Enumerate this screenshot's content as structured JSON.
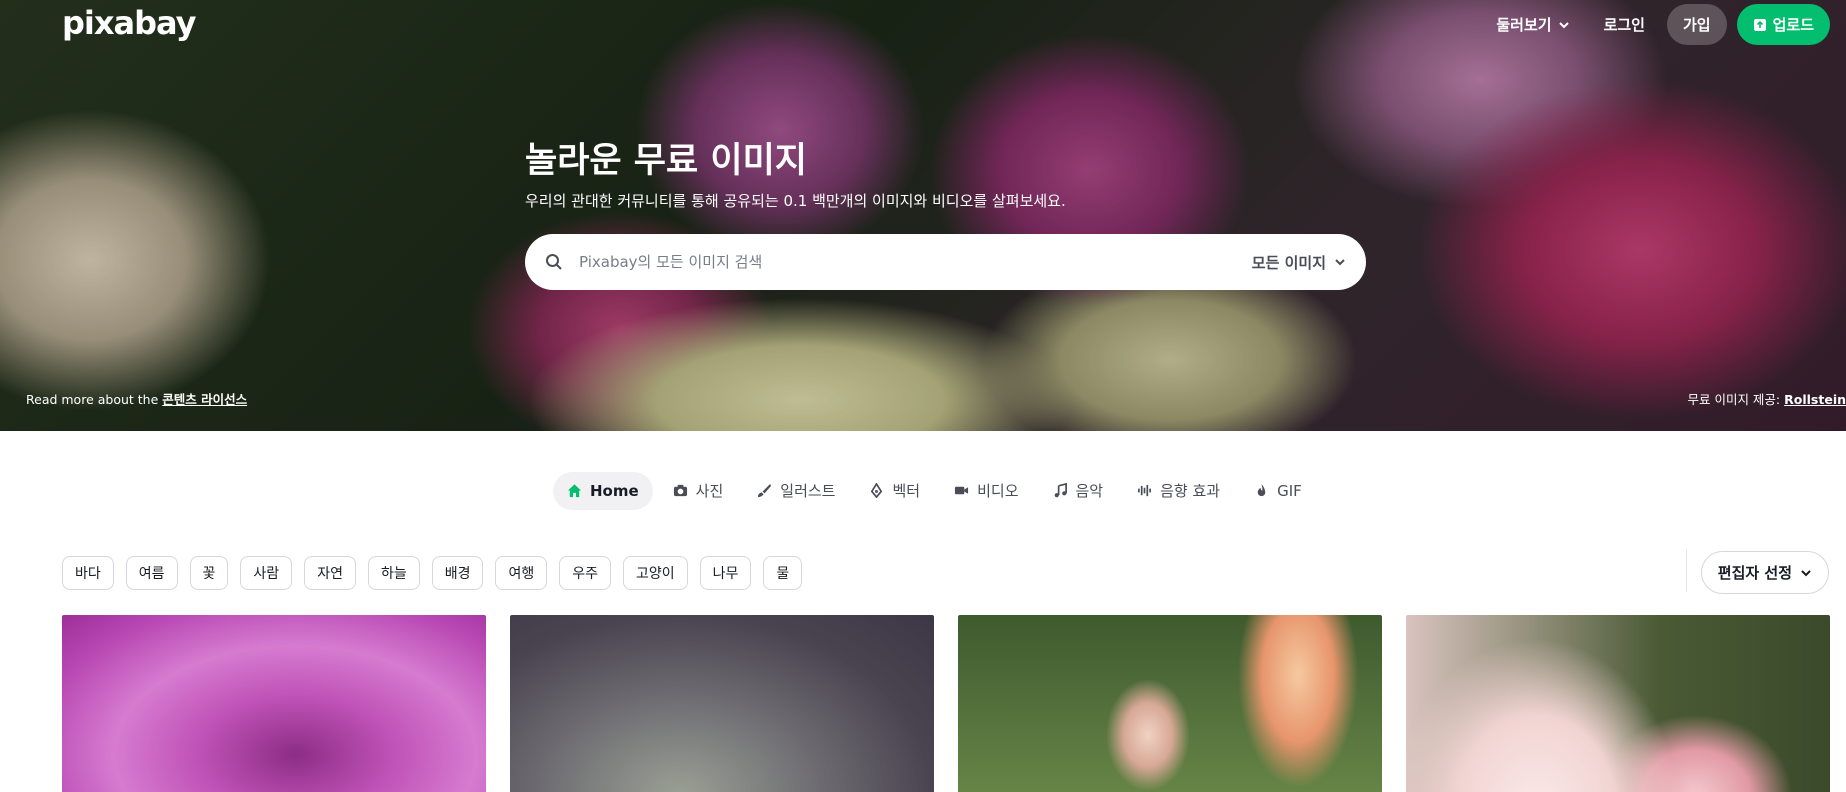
{
  "brand": {
    "logo_text": "pixabay"
  },
  "nav": {
    "explore_label": "둘러보기",
    "login_label": "로그인",
    "join_label": "가입",
    "upload_label": "업로드"
  },
  "hero": {
    "title": "놀라운 무료 이미지",
    "subtitle": "우리의 관대한 커뮤니티를 통해 공유되는 0.1 백만개의 이미지와 비디오를 살펴보세요.",
    "search_placeholder": "Pixabay의 모든 이미지 검색",
    "search_type": "모든 이미지",
    "license_prefix": "Read more about the",
    "license_link": "콘텐츠 라이선스",
    "credit_prefix": "무료 이미지 제공:",
    "credit_link": "Rollstein"
  },
  "tabs": [
    {
      "label": "Home",
      "icon": "home-icon"
    },
    {
      "label": "사진",
      "icon": "camera-icon"
    },
    {
      "label": "일러스트",
      "icon": "brush-icon"
    },
    {
      "label": "벡터",
      "icon": "pen-nib-icon"
    },
    {
      "label": "비디오",
      "icon": "video-icon"
    },
    {
      "label": "음악",
      "icon": "music-icon"
    },
    {
      "label": "음향 효과",
      "icon": "waveform-icon"
    },
    {
      "label": "GIF",
      "icon": "flame-icon"
    }
  ],
  "chips": [
    "바다",
    "여름",
    "꽃",
    "사람",
    "자연",
    "하늘",
    "배경",
    "여행",
    "우주",
    "고양이",
    "나무",
    "물"
  ],
  "sort": {
    "label": "편집자 선정"
  },
  "colors": {
    "accent": "#02be6e",
    "tab_active_icon": "#02be6e"
  }
}
